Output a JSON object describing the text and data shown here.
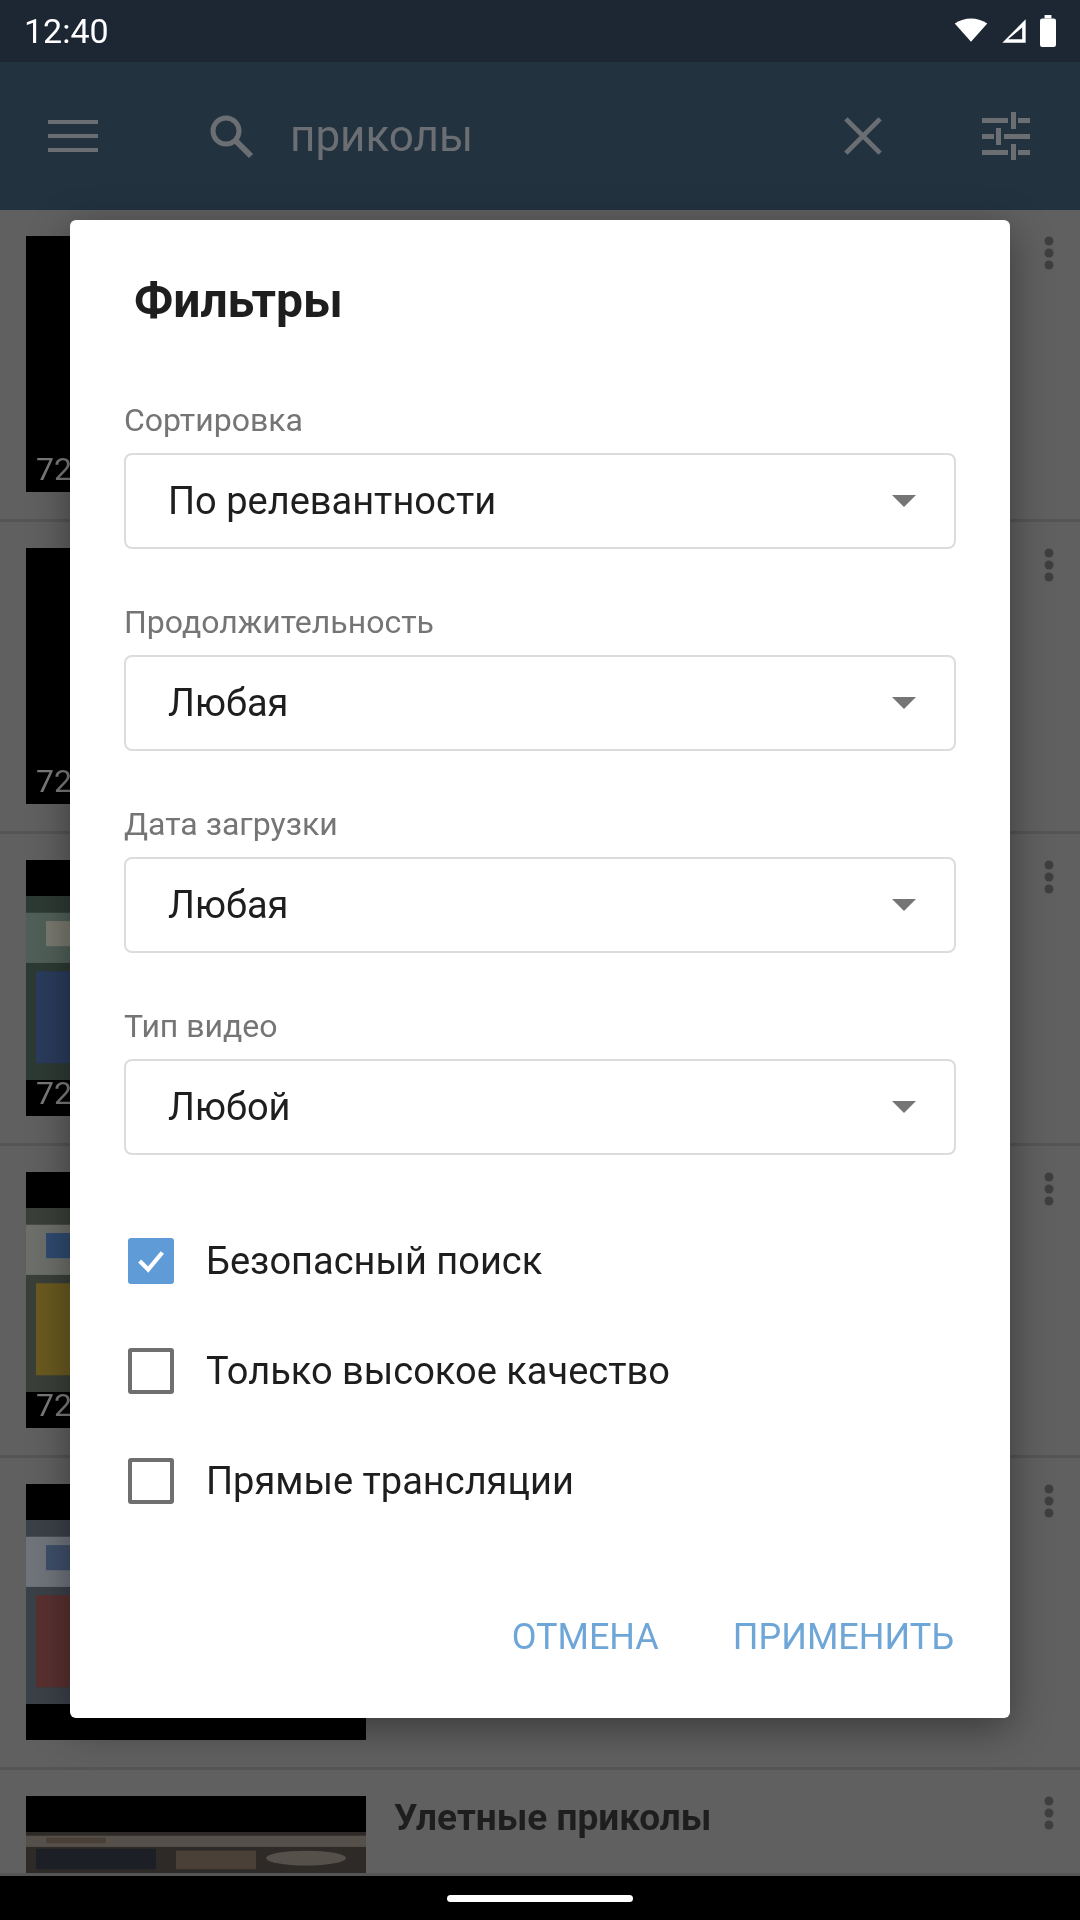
{
  "status_bar": {
    "time": "12:40"
  },
  "app_bar": {
    "search_query": "приколы"
  },
  "results": [
    {
      "kind": "black",
      "quality": "72"
    },
    {
      "kind": "black",
      "quality": "72"
    },
    {
      "kind": "picture",
      "quality": "72"
    },
    {
      "kind": "picture",
      "quality": "72"
    },
    {
      "kind": "picture"
    },
    {
      "kind": "picture",
      "title": "Улетные приколы"
    }
  ],
  "dialog": {
    "title": "Фильтры",
    "dropdowns": [
      {
        "label": "Сортировка",
        "value": "По релевантности"
      },
      {
        "label": "Продолжительность",
        "value": "Любая"
      },
      {
        "label": "Дата загрузки",
        "value": "Любая"
      },
      {
        "label": "Тип видео",
        "value": "Любой"
      }
    ],
    "checkboxes": [
      {
        "label": "Безопасный поиск",
        "checked": true
      },
      {
        "label": "Только высокое качество",
        "checked": false
      },
      {
        "label": "Прямые трансляции",
        "checked": false
      }
    ],
    "buttons": [
      "ОТМЕНА",
      "ПРИМЕНИТЬ"
    ]
  }
}
